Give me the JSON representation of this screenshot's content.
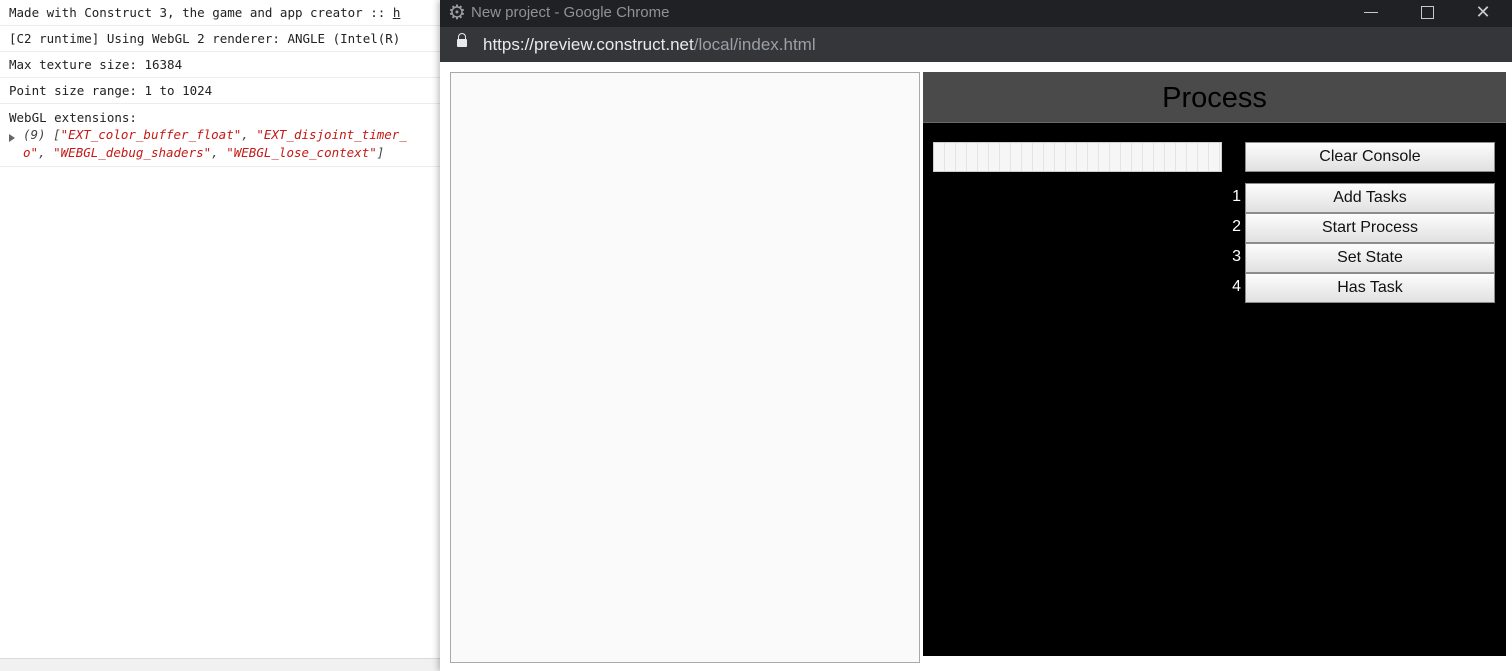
{
  "console": {
    "line1_text": "Made with Construct 3, the game and app creator :: ",
    "line1_link": "h",
    "line2": "[C2 runtime] Using WebGL 2 renderer: ANGLE (Intel(R)",
    "line3": "Max texture size: 16384",
    "line4": "Point size range: 1 to 1024",
    "line5": "WebGL extensions:",
    "array_count": "(9)",
    "array_open": " [",
    "array_item1": "\"EXT_color_buffer_float\"",
    "array_sep1": ", ",
    "array_item2": "\"EXT_disjoint_timer_",
    "array_cont": "o\"",
    "array_sep2": ", ",
    "array_item3": "\"WEBGL_debug_shaders\"",
    "array_sep3": ", ",
    "array_item4": "\"WEBGL_lose_context\"",
    "array_close": "]"
  },
  "window": {
    "title": "New project - Google Chrome",
    "icon": "gear-icon",
    "minimize_icon": "minimize-icon",
    "maximize_icon": "maximize-icon",
    "close_glyph": "✕"
  },
  "address": {
    "url_host": "https://preview.construct.net",
    "url_path": "/local/index.html"
  },
  "process": {
    "title": "Process",
    "input_value": "",
    "clear_label": "Clear Console",
    "actions": [
      {
        "number": "1",
        "label": "Add Tasks"
      },
      {
        "number": "2",
        "label": "Start Process"
      },
      {
        "number": "3",
        "label": "Set State"
      },
      {
        "number": "4",
        "label": "Has Task"
      }
    ]
  },
  "colors": {
    "titlebar": "#202124",
    "addressbar": "#35363a",
    "process_bg": "#000000",
    "process_header": "#4a4a4a",
    "console_string": "#c41a16"
  }
}
